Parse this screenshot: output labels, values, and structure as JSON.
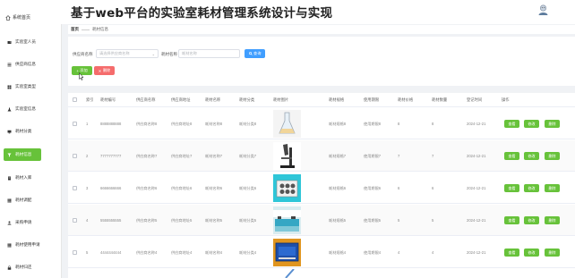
{
  "header": {
    "home_label": "系统首页",
    "title": "基于web平台的实验室耗材管理系统设计与实现"
  },
  "sidebar": {
    "items": [
      {
        "label": "实验室人员",
        "icon": "user-card-icon"
      },
      {
        "label": "供应商信息",
        "icon": "list-icon"
      },
      {
        "label": "实验室类型",
        "icon": "grid-icon"
      },
      {
        "label": "实验室信息",
        "icon": "flask-icon"
      },
      {
        "label": "耗材分类",
        "icon": "monitor-icon"
      },
      {
        "label": "耗材信息",
        "icon": "funnel-icon",
        "active": true
      },
      {
        "label": "耗材入库",
        "icon": "document-icon"
      },
      {
        "label": "耗材调配",
        "icon": "table-icon"
      },
      {
        "label": "采购申请",
        "icon": "person-icon"
      },
      {
        "label": "耗材使用申请",
        "icon": "table-icon"
      },
      {
        "label": "耗材归还",
        "icon": "lock-icon"
      }
    ]
  },
  "breadcrumb": {
    "home": "首页",
    "separator": "——",
    "current": "耗材信息"
  },
  "filter": {
    "supplier_label": "供应商名称",
    "supplier_placeholder": "请选择供应商名称",
    "name_label": "耗材名称",
    "name_placeholder": "耗材名称",
    "search_label": "查询",
    "add_label": "添加",
    "delete_label": "删除"
  },
  "table": {
    "headers": [
      "索引",
      "耗材编号",
      "供应商名称",
      "供应商地址",
      "耗材名称",
      "耗材分类",
      "耗材图片",
      "耗材规格",
      "使用期限",
      "耗材价格",
      "耗材数量",
      "登记时间",
      "操作"
    ],
    "rows": [
      {
        "index": "1",
        "code": "8888888888",
        "supplier": "供应商名称8",
        "address": "供应商地址8",
        "name": "耗材名称8",
        "category": "耗材分类8",
        "spec": "耗材规格8",
        "period": "使用期限8",
        "price": "8",
        "qty": "8",
        "date": "2024-12-21",
        "image": "beaker"
      },
      {
        "index": "2",
        "code": "7777777777",
        "supplier": "供应商名称7",
        "address": "供应商地址7",
        "name": "耗材名称7",
        "category": "耗材分类7",
        "spec": "耗材规格7",
        "period": "使用期限7",
        "price": "7",
        "qty": "7",
        "date": "2024-12-21",
        "image": "microscope"
      },
      {
        "index": "3",
        "code": "6666666666",
        "supplier": "供应商名称6",
        "address": "供应商地址6",
        "name": "耗材名称6",
        "category": "耗材分类6",
        "spec": "耗材规格6",
        "period": "使用期限6",
        "price": "6",
        "qty": "6",
        "date": "2024-12-21",
        "image": "water-bath"
      },
      {
        "index": "4",
        "code": "5555555555",
        "supplier": "供应商名称5",
        "address": "供应商地址5",
        "name": "耗材名称5",
        "category": "耗材分类5",
        "spec": "耗材规格5",
        "period": "使用期限5",
        "price": "5",
        "qty": "5",
        "date": "2024-12-21",
        "image": "lab-bench"
      },
      {
        "index": "5",
        "code": "4444444444",
        "supplier": "供应商名称4",
        "address": "供应商地址4",
        "name": "耗材名称4",
        "category": "耗材分类4",
        "spec": "耗材规格4",
        "period": "使用期限4",
        "price": "4",
        "qty": "4",
        "date": "2024-12-21",
        "image": "instrument"
      }
    ],
    "actions": {
      "view": "查看",
      "edit": "修改",
      "delete": "删除"
    }
  },
  "colors": {
    "accent_green": "#67c23a",
    "search_blue": "#409eff",
    "danger_red": "#f56c6c"
  }
}
